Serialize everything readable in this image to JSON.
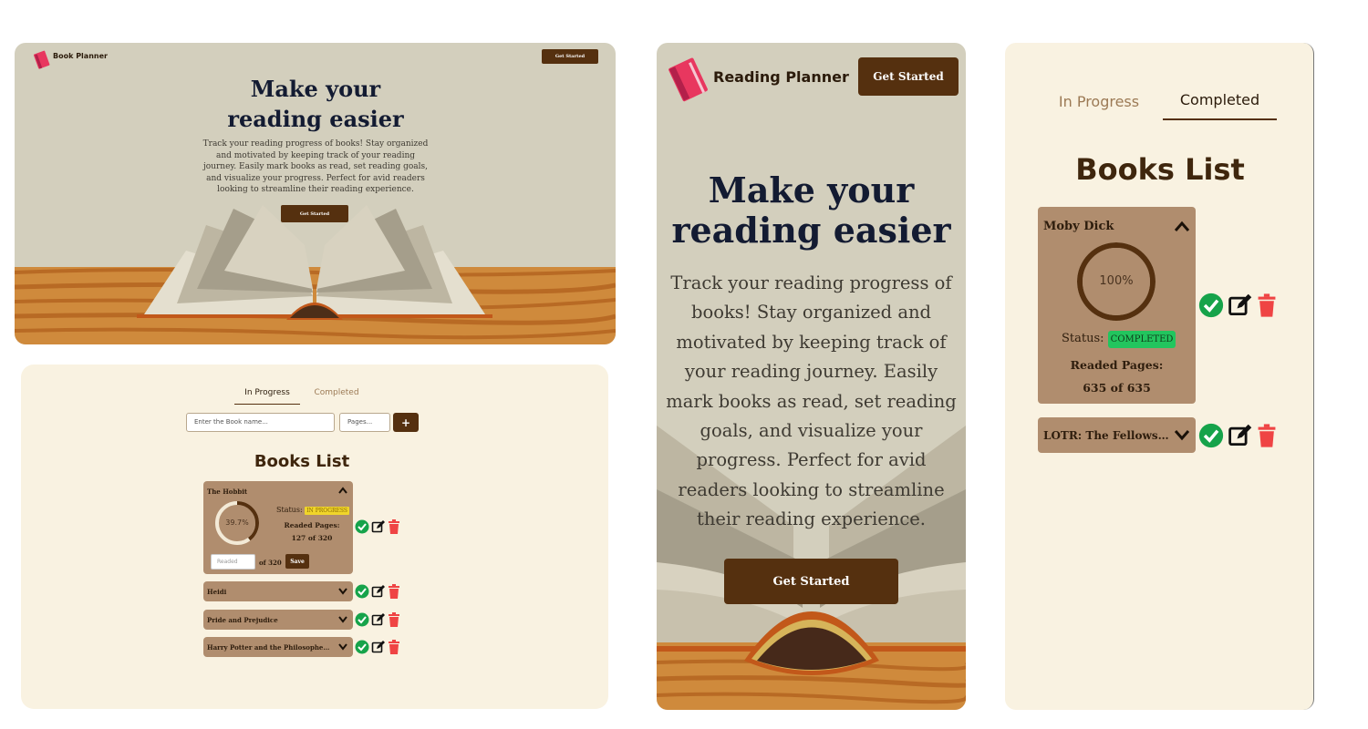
{
  "colors": {
    "accent": "#55300f",
    "hero_bg": "#d3cfbd",
    "list_bg": "#f9f2e1",
    "card_bg": "#b08d6e",
    "complete_green": "#22c55e",
    "delete_red": "#ef4444",
    "progress_yellow": "#f0d52a"
  },
  "desktop_hero": {
    "brand": "Book Planner",
    "nav_button": "Get Started",
    "title_line1": "Make your",
    "title_line2": "reading easier",
    "description": "Track your reading progress of books! Stay organized and motivated by keeping track of your reading journey. Easily mark books as read, set reading goals, and visualize your progress. Perfect for avid readers looking to streamline their reading experience.",
    "cta": "Get Started",
    "logo_icon": "book-icon"
  },
  "desktop_list": {
    "tabs": [
      {
        "label": "In Progress",
        "active": true
      },
      {
        "label": "Completed",
        "active": false
      }
    ],
    "name_placeholder": "Enter the Book name...",
    "pages_placeholder": "Pages...",
    "add_label": "+",
    "list_title": "Books List",
    "expanded_book": {
      "title": "The Hobbit",
      "progress_label": "39.7%",
      "progress": 0.397,
      "status_label": "Status:",
      "status": "IN PROGRESS",
      "readed_label": "Readed Pages:",
      "readed_value": "127 of 320",
      "readed_placeholder": "Readed",
      "of_total": "of 320",
      "save_label": "Save"
    },
    "collapsed_books": [
      {
        "title": "Heidi"
      },
      {
        "title": "Pride and Prejudice"
      },
      {
        "title": "Harry Potter and the Philosopher's Stone"
      }
    ],
    "action_icons": [
      "check-circle-icon",
      "edit-icon",
      "trash-icon"
    ]
  },
  "mobile_hero": {
    "brand": "Reading Planner",
    "nav_button": "Get Started",
    "title_line1": "Make your",
    "title_line2": "reading easier",
    "description": "Track your reading progress of books! Stay organized and motivated by keeping track of your reading journey. Easily mark books as read, set reading goals, and visualize your progress. Perfect for avid readers looking to streamline their reading experience.",
    "cta": "Get Started"
  },
  "mobile_list": {
    "tabs": [
      {
        "label": "In Progress",
        "active": false
      },
      {
        "label": "Completed",
        "active": true
      }
    ],
    "list_title": "Books List",
    "expanded_book": {
      "title": "Moby Dick",
      "progress_label": "100%",
      "progress": 1.0,
      "status_label": "Status:",
      "status": "COMPLETED",
      "readed_label": "Readed Pages:",
      "readed_value": "635 of 635"
    },
    "collapsed_books": [
      {
        "title": "LOTR: The Fellowship of the Ring"
      }
    ]
  }
}
